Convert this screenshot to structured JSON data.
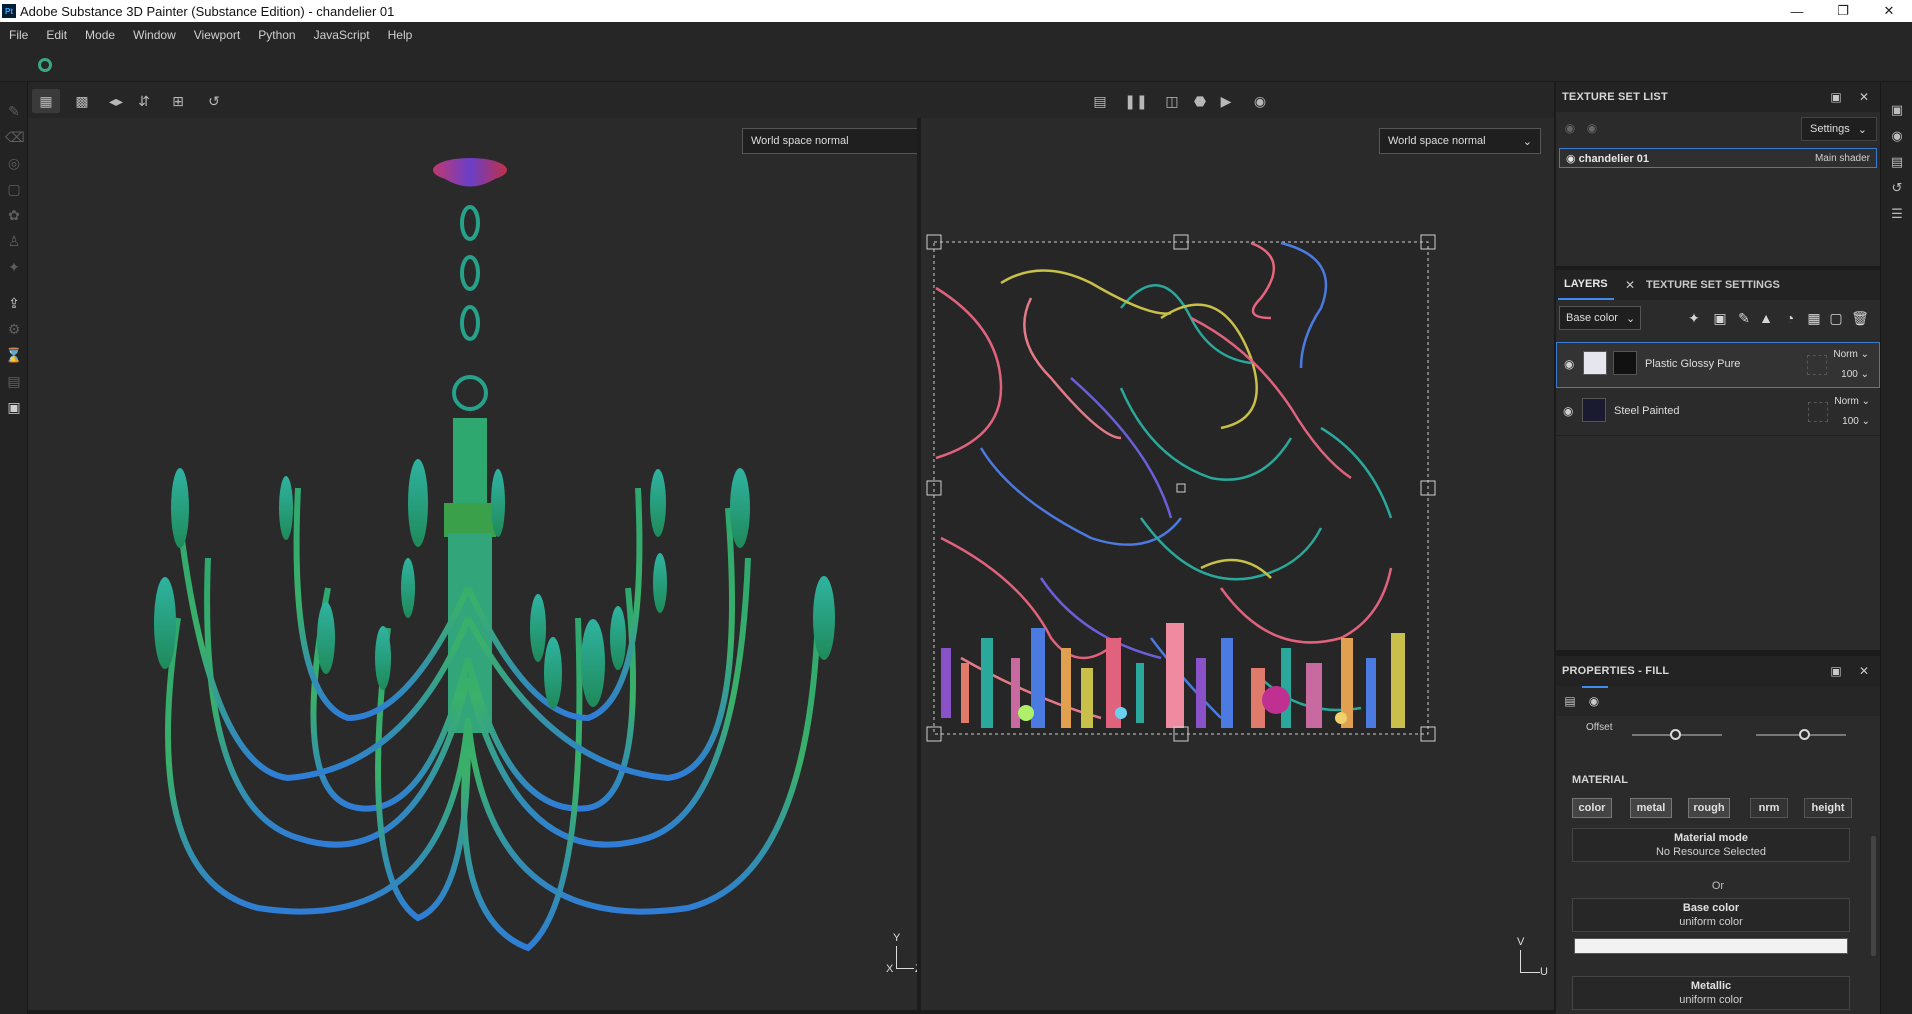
{
  "window": {
    "title": "Adobe Substance 3D Painter (Substance Edition) - chandelier 01",
    "app_icon_text": "Pt",
    "controls": [
      "minimize",
      "restore",
      "close"
    ]
  },
  "menu": [
    "File",
    "Edit",
    "Mode",
    "Window",
    "Viewport",
    "Python",
    "JavaScript",
    "Help"
  ],
  "viewport_3d": {
    "channel_select": "World space normal",
    "axis_y": "Y",
    "axis_x": "X",
    "axis_z": "Z"
  },
  "viewport_2d": {
    "channel_select": "World space normal",
    "axis_v": "V",
    "axis_u": "U"
  },
  "texture_set_list": {
    "title": "TEXTURE SET LIST",
    "settings_label": "Settings",
    "items": [
      {
        "name": "chandelier 01",
        "shader": "Main shader"
      }
    ]
  },
  "layers_panel": {
    "tab_layers": "LAYERS",
    "tab_settings": "TEXTURE SET SETTINGS",
    "channel": "Base color",
    "layers": [
      {
        "name": "Plastic Glossy Pure",
        "blend": "Norm",
        "opacity": "100",
        "selected": true
      },
      {
        "name": "Steel Painted",
        "blend": "Norm",
        "opacity": "100",
        "selected": false
      }
    ]
  },
  "properties": {
    "title": "PROPERTIES - FILL",
    "offset_label": "Offset",
    "material_label": "MATERIAL",
    "material_buttons": [
      "color",
      "metal",
      "rough",
      "nrm",
      "height"
    ],
    "material_mode": {
      "title": "Material mode",
      "value": "No Resource Selected"
    },
    "or_label": "Or",
    "base_color": {
      "title": "Base color",
      "value": "uniform color",
      "swatch": "#f2f2f2"
    },
    "metallic": {
      "title": "Metallic",
      "value": "uniform color"
    }
  },
  "colors": {
    "accent_blue": "#3d7ad1",
    "background": "#2a2a2a"
  }
}
